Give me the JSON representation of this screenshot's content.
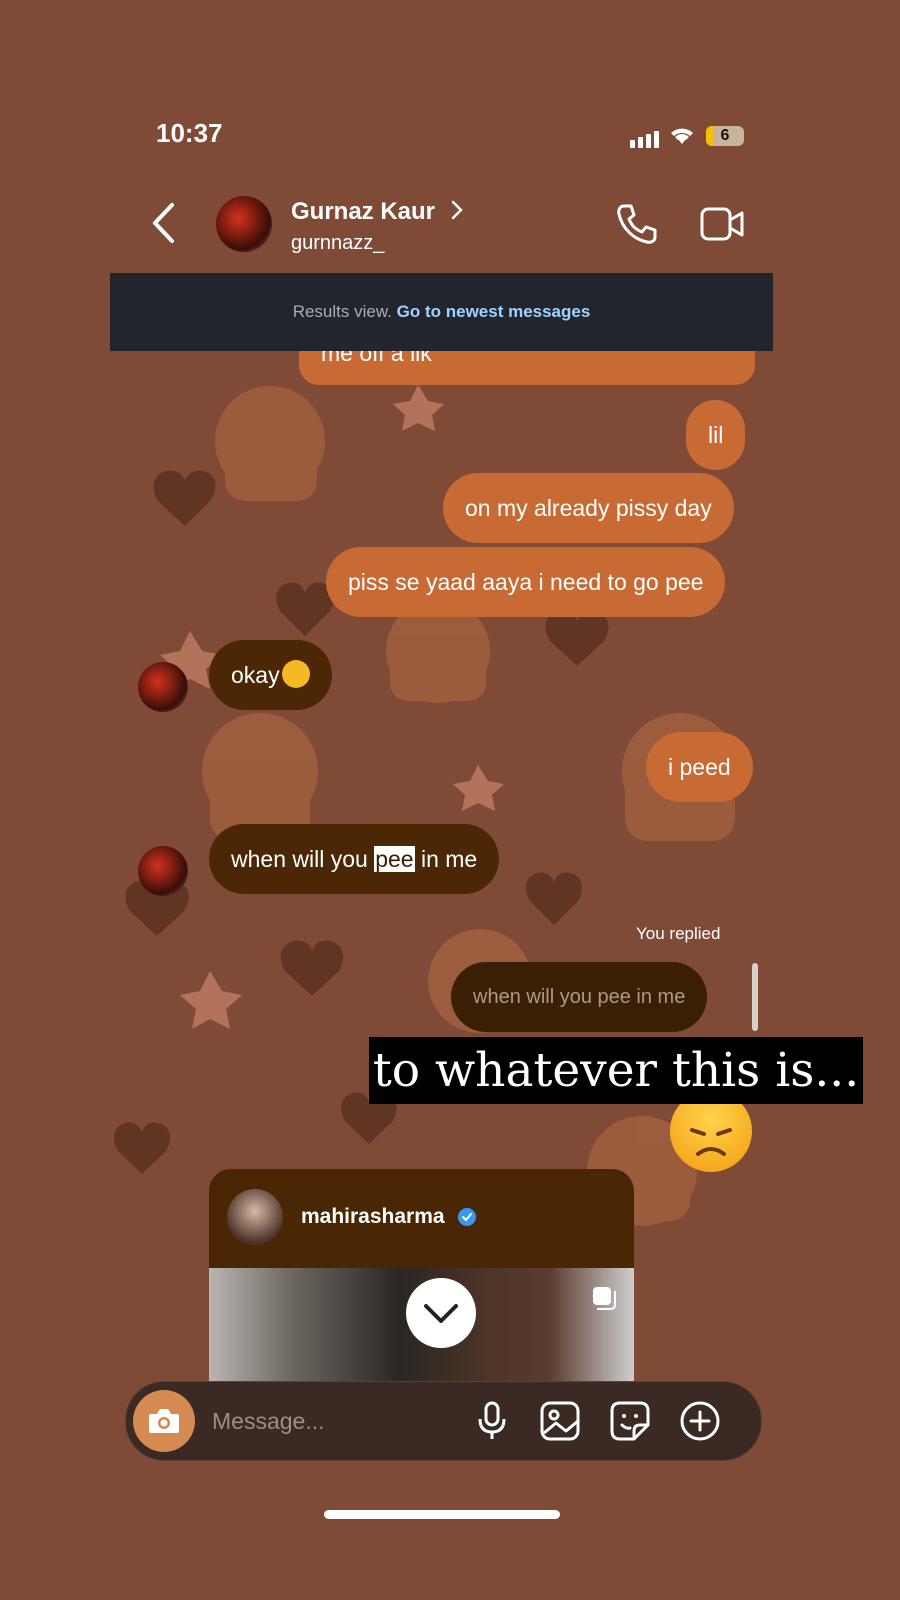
{
  "status_bar": {
    "time": "10:37",
    "battery": "6"
  },
  "header": {
    "name": "Gurnaz Kaur",
    "username": "gurnnazz_"
  },
  "banner": {
    "text": "Results view.",
    "link": "Go to newest messages"
  },
  "messages": {
    "m1": "me off a lik",
    "m2": "lil",
    "m3": "on my already pissy day",
    "m4": "piss se yaad aaya i need to go pee",
    "m5": "okay",
    "m6": "i peed",
    "m7_before": "when will you ",
    "m7_highlight": "pee",
    "m7_after": " in me",
    "replied_label": "You replied",
    "reply_quote": "when will you pee in me"
  },
  "overlay_caption": "to whatever this is...",
  "shared_post": {
    "username": "mahirasharma"
  },
  "composer": {
    "placeholder": "Message..."
  },
  "colors": {
    "background": "#7f4b37",
    "outgoing": "#c86a33",
    "incoming": "#4b2705",
    "link": "#9fd3ff"
  },
  "icons": [
    "back-chevron-icon",
    "phone-icon",
    "video-icon",
    "camera-icon",
    "microphone-icon",
    "gallery-icon",
    "sticker-icon",
    "plus-circle-icon",
    "verified-badge-icon",
    "chevron-down-icon"
  ]
}
